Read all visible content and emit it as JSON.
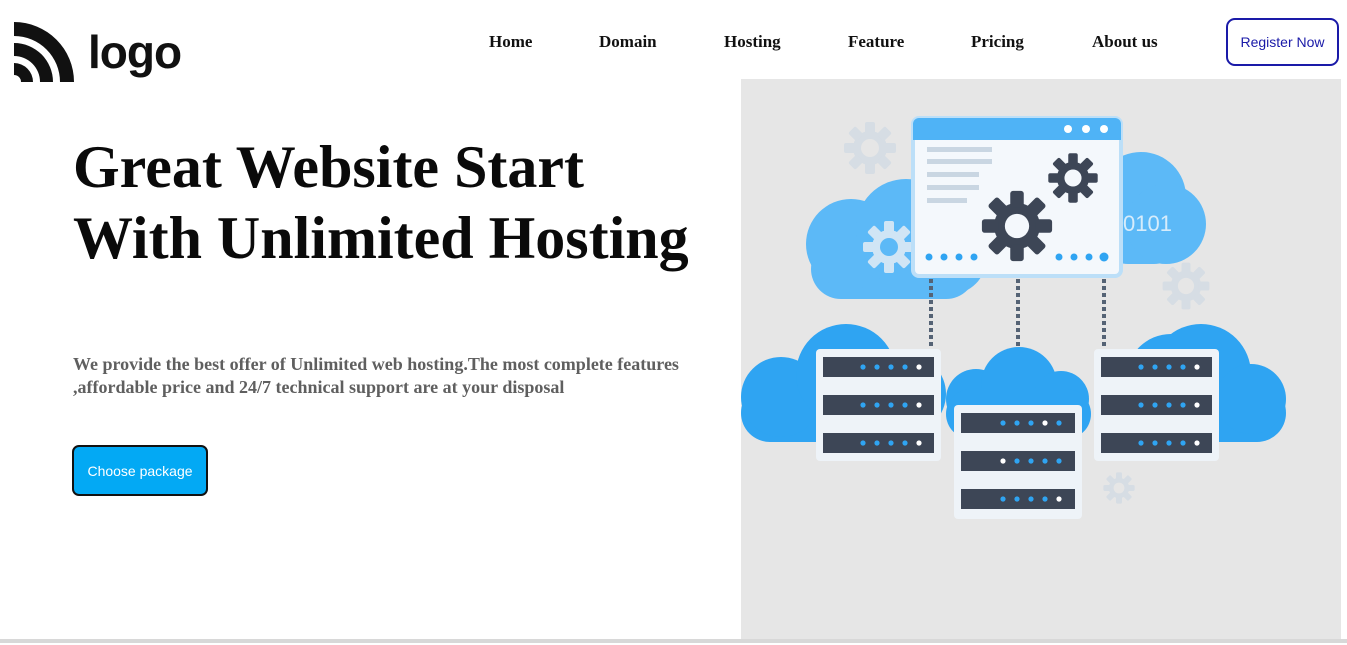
{
  "brand": {
    "logo_text": "logo",
    "logo_icon": "wifi-arcs-logo-icon"
  },
  "nav": {
    "items": [
      {
        "label": "Home"
      },
      {
        "label": "Domain"
      },
      {
        "label": "Hosting"
      },
      {
        "label": "Feature"
      },
      {
        "label": "Pricing"
      },
      {
        "label": "About us"
      }
    ],
    "register_label": "Register Now"
  },
  "hero": {
    "title": "Great Website Start With Unlimited Hosting",
    "description": "We provide the best offer of Unlimited web hosting.The most complete features ,affordable price and 24/7 technical support are at your disposal",
    "cta_label": "Choose package"
  },
  "illustration": {
    "binary_text": "0101",
    "icons": [
      "cloud-icon",
      "server-rack-icon",
      "gear-icon",
      "browser-window-icon"
    ]
  },
  "colors": {
    "accent": "#03a9f4",
    "register_border": "#1a1aa8",
    "description_text": "#5f5f5f",
    "illustration_bg": "#e6e6e6",
    "cloud_blue": "#4fb3f6",
    "server_dark": "#3d4656"
  }
}
